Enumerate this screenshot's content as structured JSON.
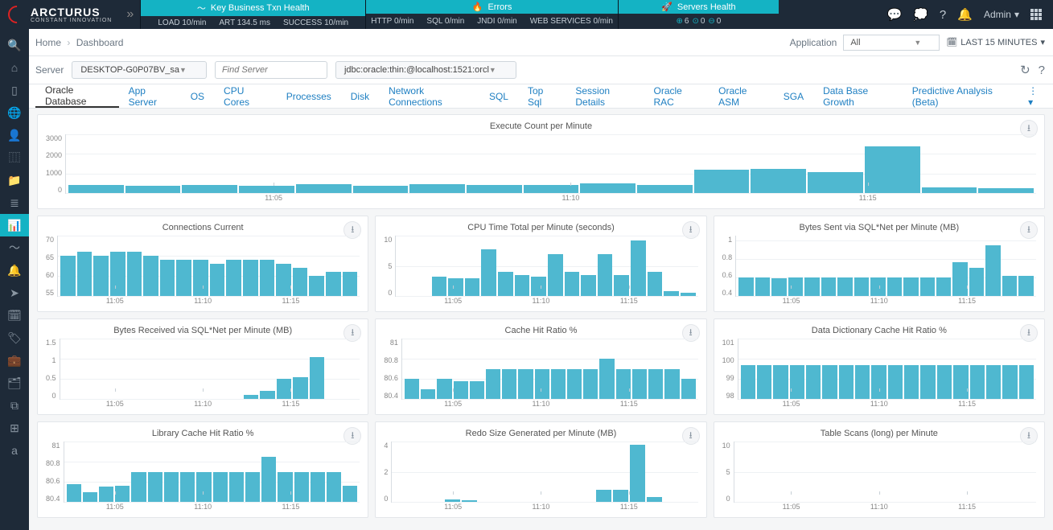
{
  "brand": {
    "name": "ARCTURUS",
    "tag": "CONSTANT INNOVATION"
  },
  "health": {
    "biz": {
      "title": "Key Business Txn Health",
      "load": "LOAD 10/min",
      "art": "ART 134.5 ms",
      "success": "SUCCESS 10/min"
    },
    "err": {
      "title": "Errors",
      "http": "HTTP 0/min",
      "sql": "SQL 0/min",
      "jndi": "JNDI 0/min",
      "ws": "WEB SERVICES 0/min"
    },
    "srv": {
      "title": "Servers Health",
      "up": "6",
      "warn": "0",
      "down": "0"
    }
  },
  "admin_label": "Admin",
  "crumbs": {
    "home": "Home",
    "dash": "Dashboard"
  },
  "app_label": "Application",
  "app_value": "All",
  "timerange": "LAST 15 MINUTES",
  "server_label": "Server",
  "server_value": "DESKTOP-G0P07BV_sa",
  "find_placeholder": "Find Server",
  "jdbc_value": "jdbc:oracle:thin:@localhost:1521:orcl",
  "tabs": [
    "Oracle Database",
    "App Server",
    "OS",
    "CPU Cores",
    "Processes",
    "Disk",
    "Network Connections",
    "SQL",
    "Top Sql",
    "Session Details",
    "Oracle RAC",
    "Oracle ASM",
    "SGA",
    "Data Base Growth",
    "Predictive Analysis (Beta)"
  ],
  "sidebar_icons": [
    "search-icon",
    "home-icon",
    "device-icon",
    "globe-icon",
    "user-icon",
    "columns-icon",
    "folder-icon",
    "layers-icon",
    "chart-icon",
    "trend-icon",
    "bell-icon",
    "send-icon",
    "calendar-icon",
    "tag-icon",
    "briefcase-icon",
    "folder2-icon",
    "window-icon",
    "grid-icon",
    "alpha-icon"
  ],
  "x_ticks": [
    "11:05",
    "11:10",
    "11:15"
  ],
  "chart_data": [
    {
      "id": "exec",
      "type": "bar",
      "title": "Execute Count per Minute",
      "ylabel": "",
      "y_ticks": [
        0,
        1000,
        2000,
        3000
      ],
      "ylim": [
        0,
        3000
      ],
      "values": [
        400,
        350,
        400,
        350,
        450,
        380,
        450,
        400,
        420,
        480,
        430,
        1200,
        1250,
        1050,
        2400,
        280,
        260
      ]
    },
    {
      "id": "conn",
      "type": "bar",
      "title": "Connections Current",
      "y_ticks": [
        55,
        60,
        65,
        70
      ],
      "ylim": [
        55,
        70
      ],
      "values": [
        65,
        66,
        65,
        66,
        66,
        65,
        64,
        64,
        64,
        63,
        64,
        64,
        64,
        63,
        62,
        60,
        61,
        61
      ]
    },
    {
      "id": "cpu",
      "type": "bar",
      "title": "CPU Time Total per Minute (seconds)",
      "y_ticks": [
        0,
        5,
        10
      ],
      "ylim": [
        0,
        10
      ],
      "values": [
        0,
        0,
        3.2,
        3,
        3,
        7.8,
        4,
        3.5,
        3.2,
        7,
        4,
        3.5,
        7,
        3.5,
        9.2,
        4,
        0.8,
        0.5
      ]
    },
    {
      "id": "bytes_sent",
      "type": "bar",
      "title": "Bytes Sent via SQL*Net per Minute (MB)",
      "y_ticks": [
        0.4,
        0.6,
        0.8,
        1.0
      ],
      "ylim": [
        0.4,
        1.05
      ],
      "values": [
        0.6,
        0.6,
        0.59,
        0.6,
        0.6,
        0.6,
        0.6,
        0.6,
        0.6,
        0.6,
        0.6,
        0.6,
        0.6,
        0.76,
        0.7,
        0.95,
        0.62,
        0.62
      ]
    },
    {
      "id": "bytes_recv",
      "type": "bar",
      "title": "Bytes Received via SQL*Net per Minute (MB)",
      "y_ticks": [
        0.0,
        0.5,
        1.0,
        1.5
      ],
      "ylim": [
        0,
        1.5
      ],
      "values": [
        0,
        0,
        0,
        0,
        0,
        0,
        0,
        0,
        0,
        0,
        0,
        0.1,
        0.2,
        0.5,
        0.55,
        1.05,
        0,
        0
      ]
    },
    {
      "id": "cache_hit",
      "type": "bar",
      "title": "Cache Hit Ratio %",
      "y_ticks": [
        80.4,
        80.6,
        80.8,
        81.0
      ],
      "ylim": [
        80.4,
        81.0
      ],
      "values": [
        80.6,
        80.5,
        80.6,
        80.58,
        80.58,
        80.7,
        80.7,
        80.7,
        80.7,
        80.7,
        80.7,
        80.7,
        80.8,
        80.7,
        80.7,
        80.7,
        80.7,
        80.6
      ]
    },
    {
      "id": "dict_hit",
      "type": "bar",
      "title": "Data Dictionary Cache Hit Ratio %",
      "y_ticks": [
        98,
        99,
        100,
        101
      ],
      "ylim": [
        98,
        101
      ],
      "values": [
        99.7,
        99.7,
        99.7,
        99.7,
        99.7,
        99.7,
        99.7,
        99.7,
        99.7,
        99.7,
        99.7,
        99.7,
        99.7,
        99.7,
        99.7,
        99.7,
        99.7,
        99.7
      ]
    },
    {
      "id": "lib_hit",
      "type": "bar",
      "title": "Library Cache Hit Ratio %",
      "y_ticks": [
        80.4,
        80.6,
        80.8,
        81.0
      ],
      "ylim": [
        80.4,
        81.0
      ],
      "values": [
        80.58,
        80.5,
        80.55,
        80.56,
        80.7,
        80.7,
        80.7,
        80.7,
        80.7,
        80.7,
        80.7,
        80.7,
        80.85,
        80.7,
        80.7,
        80.7,
        80.7,
        80.56
      ]
    },
    {
      "id": "redo",
      "type": "bar",
      "title": "Redo Size Generated per Minute (MB)",
      "y_ticks": [
        0,
        2,
        4
      ],
      "ylim": [
        0,
        4
      ],
      "values": [
        0,
        0,
        0,
        0.15,
        0.1,
        0,
        0,
        0,
        0,
        0,
        0,
        0,
        0.8,
        0.8,
        3.8,
        0.3,
        0,
        0
      ]
    },
    {
      "id": "tscans",
      "type": "bar",
      "title": "Table Scans (long) per Minute",
      "y_ticks": [
        0,
        5,
        10
      ],
      "ylim": [
        0,
        10
      ],
      "values": [
        0,
        0,
        0,
        0,
        0,
        0,
        0,
        0,
        0,
        0,
        0,
        0,
        0,
        0,
        0,
        0,
        0,
        0
      ]
    }
  ]
}
